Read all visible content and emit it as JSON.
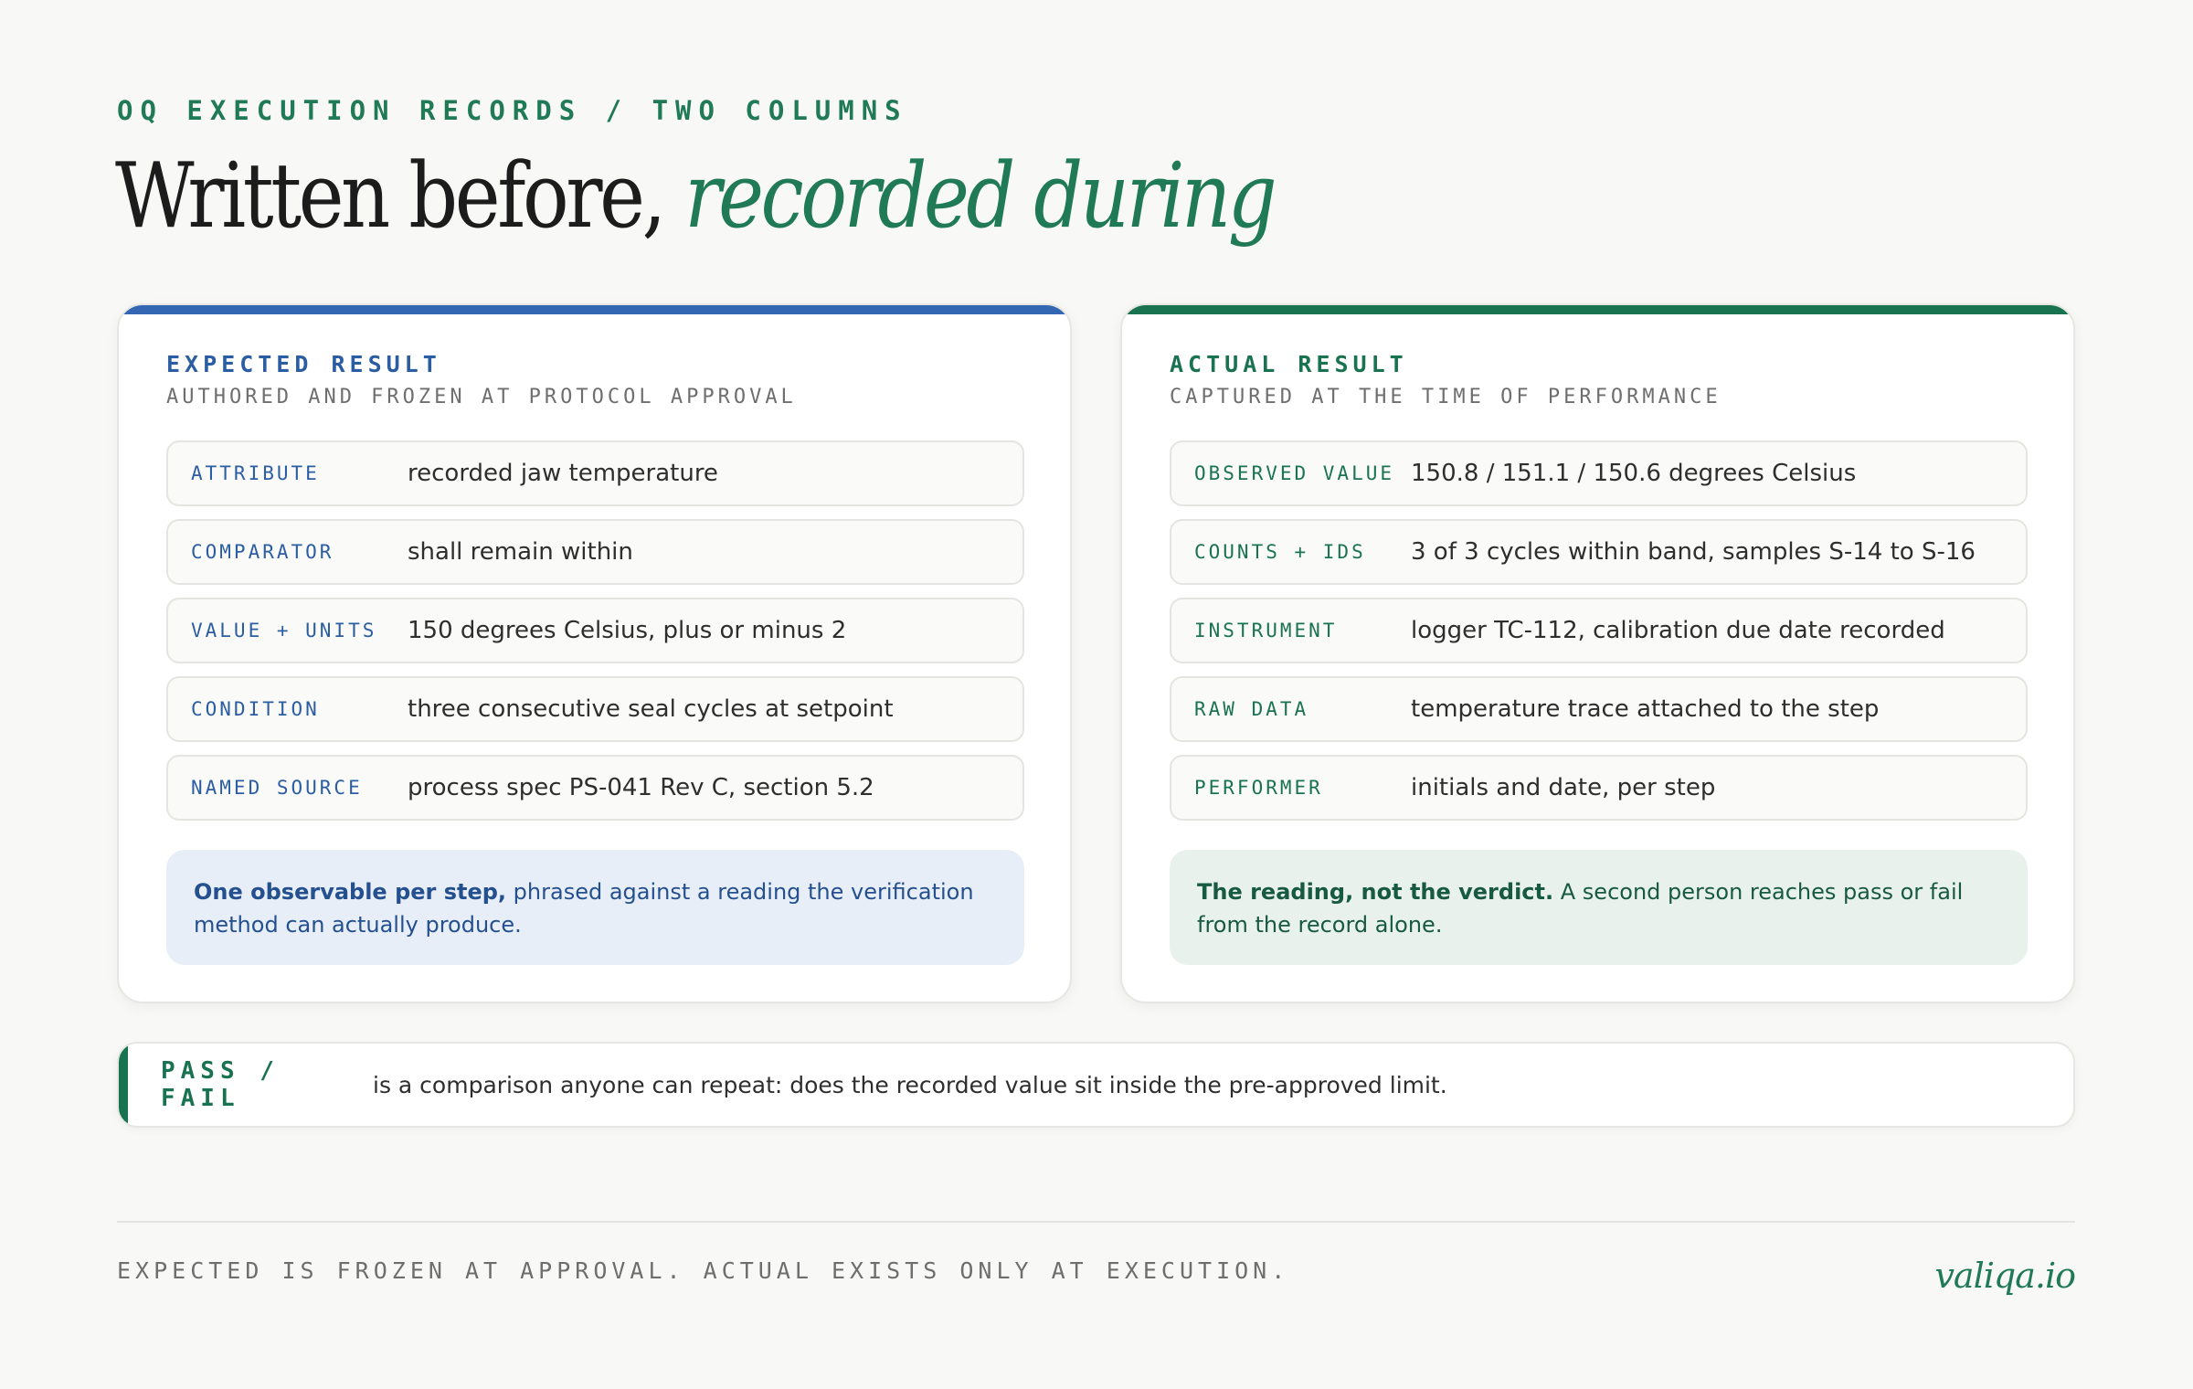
{
  "header": {
    "eyebrow": "OQ EXECUTION RECORDS / TWO COLUMNS",
    "title_plain": "Written before, ",
    "title_accent": "recorded during"
  },
  "expected": {
    "title": "EXPECTED RESULT",
    "subtitle": "AUTHORED AND FROZEN AT PROTOCOL APPROVAL",
    "rows": [
      {
        "key": "ATTRIBUTE",
        "value": "recorded jaw temperature"
      },
      {
        "key": "COMPARATOR",
        "value": "shall remain within"
      },
      {
        "key": "VALUE + UNITS",
        "value": "150 degrees Celsius, plus or minus 2"
      },
      {
        "key": "CONDITION",
        "value": "three consecutive seal cycles at setpoint"
      },
      {
        "key": "NAMED SOURCE",
        "value": "process spec PS-041 Rev C, section 5.2"
      }
    ],
    "note_bold": "One observable per step,",
    "note_text": " phrased against a reading the verification method can actually produce."
  },
  "actual": {
    "title": "ACTUAL RESULT",
    "subtitle": "CAPTURED AT THE TIME OF PERFORMANCE",
    "rows": [
      {
        "key": "OBSERVED VALUE",
        "value": "150.8 / 151.1 / 150.6 degrees Celsius"
      },
      {
        "key": "COUNTS + IDS",
        "value": "3 of 3 cycles within band, samples S-14 to S-16"
      },
      {
        "key": "INSTRUMENT",
        "value": "logger TC-112, calibration due date recorded"
      },
      {
        "key": "RAW DATA",
        "value": "temperature trace attached to the step"
      },
      {
        "key": "PERFORMER",
        "value": "initials and date, per step"
      }
    ],
    "note_bold": "The reading, not the verdict.",
    "note_text": " A second person reaches pass or fail from the record alone."
  },
  "passfail": {
    "label": "PASS / FAIL",
    "text": "is a comparison anyone can repeat: does the recorded value sit inside the pre-approved limit."
  },
  "footer": {
    "text": "EXPECTED IS FROZEN AT APPROVAL. ACTUAL EXISTS ONLY AT EXECUTION.",
    "brand": "valiqa.io"
  },
  "colors": {
    "expected_accent": "#3366b3",
    "actual_accent": "#1a7350",
    "background": "#f8f8f6"
  }
}
